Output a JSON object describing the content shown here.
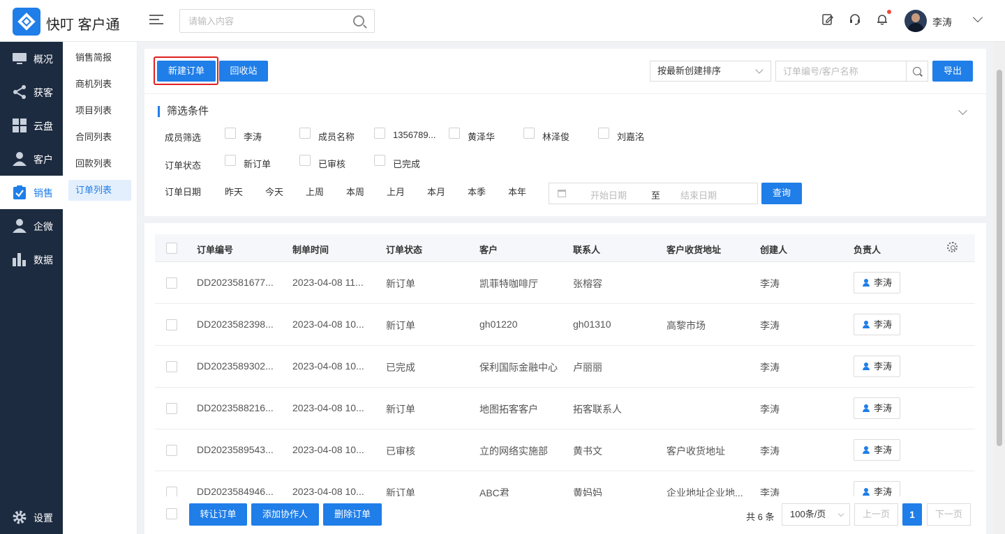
{
  "app": {
    "title": "快叮 客户通"
  },
  "topbar": {
    "search_placeholder": "请输入内容",
    "icons": [
      "edit-icon",
      "headset-icon",
      "bell-icon"
    ],
    "user_name": "李涛"
  },
  "sidebar": {
    "items": [
      {
        "label": "概况",
        "icon": "monitor-icon"
      },
      {
        "label": "获客",
        "icon": "share-icon"
      },
      {
        "label": "云盘",
        "icon": "grid-icon"
      },
      {
        "label": "客户",
        "icon": "person-icon"
      },
      {
        "label": "销售",
        "icon": "clipboard-check-icon",
        "active": true
      },
      {
        "label": "企微",
        "icon": "person-icon"
      },
      {
        "label": "数据",
        "icon": "bar-chart-icon"
      }
    ],
    "settings_label": "设置"
  },
  "subnav": {
    "items": [
      "销售简报",
      "商机列表",
      "项目列表",
      "合同列表",
      "回款列表",
      "订单列表"
    ],
    "active_index": 5
  },
  "toolbar": {
    "new_order": "新建订单",
    "recycle_bin": "回收站",
    "sort_value": "按最新创建排序",
    "search_placeholder": "订单编号/客户名称",
    "export": "导出"
  },
  "filters": {
    "title": "筛选条件",
    "member_label": "成员筛选",
    "members": [
      "李涛",
      "成员名称",
      "1356789...",
      "黄泽华",
      "林泽俊",
      "刘嘉洺"
    ],
    "status_label": "订单状态",
    "statuses": [
      "新订单",
      "已审核",
      "已完成"
    ],
    "date_label": "订单日期",
    "date_options": [
      "昨天",
      "今天",
      "上周",
      "本周",
      "上月",
      "本月",
      "本季",
      "本年"
    ],
    "start_placeholder": "开始日期",
    "range_sep": "至",
    "end_placeholder": "结束日期",
    "query": "查询"
  },
  "table": {
    "columns": [
      "订单编号",
      "制单时间",
      "订单状态",
      "客户",
      "联系人",
      "客户收货地址",
      "创建人",
      "负责人"
    ],
    "rows": [
      {
        "id": "DD2023581677...",
        "time": "2023-04-08 11...",
        "status": "新订单",
        "customer": "凯菲特咖啡厅",
        "contact": "张榕容",
        "address": "",
        "creator": "李涛",
        "owner": "李涛"
      },
      {
        "id": "DD2023582398...",
        "time": "2023-04-08 10...",
        "status": "新订单",
        "customer": "gh01220",
        "contact": "gh01310",
        "address": "高黎市场",
        "creator": "李涛",
        "owner": "李涛"
      },
      {
        "id": "DD2023589302...",
        "time": "2023-04-08 10...",
        "status": "已完成",
        "customer": "保利国际金融中心",
        "contact": "卢丽丽",
        "address": "",
        "creator": "李涛",
        "owner": "李涛"
      },
      {
        "id": "DD2023588216...",
        "time": "2023-04-08 10...",
        "status": "新订单",
        "customer": "地图拓客客户",
        "contact": "拓客联系人",
        "address": "",
        "creator": "李涛",
        "owner": "李涛"
      },
      {
        "id": "DD2023589543...",
        "time": "2023-04-08 10...",
        "status": "已审核",
        "customer": "立的网络实施部",
        "contact": "黄书文",
        "address": "客户收货地址",
        "creator": "李涛",
        "owner": "李涛"
      },
      {
        "id": "DD2023584946...",
        "time": "2023-04-08 10...",
        "status": "新订单",
        "customer": "ABC君",
        "contact": "黄妈妈",
        "address": "企业地址企业地...",
        "creator": "李涛",
        "owner": "李涛"
      }
    ]
  },
  "footer": {
    "transfer": "转让订单",
    "add_collab": "添加协作人",
    "delete": "删除订单",
    "total": "共 6 条",
    "page_size": "100条/页",
    "prev": "上一页",
    "page": "1",
    "next": "下一页"
  },
  "colors": {
    "accent": "#1f7ee8",
    "sidebar": "#1d2b40",
    "highlight": "#e02020"
  }
}
